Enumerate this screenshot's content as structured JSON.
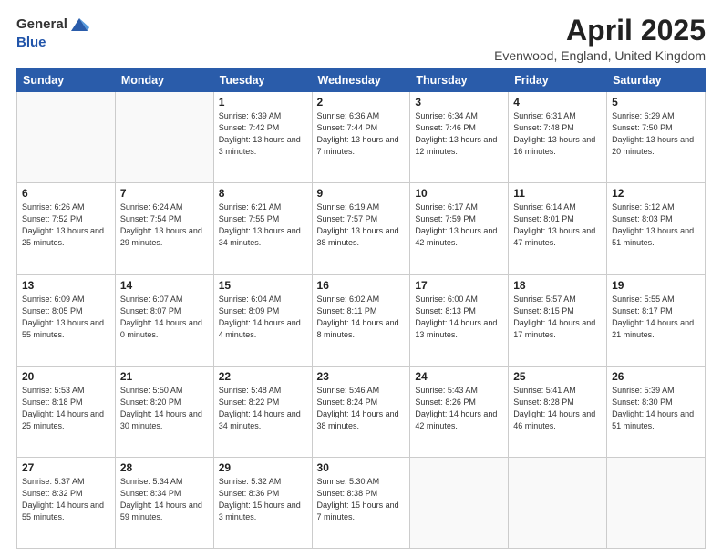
{
  "header": {
    "logo_general": "General",
    "logo_blue": "Blue",
    "month_year": "April 2025",
    "location": "Evenwood, England, United Kingdom"
  },
  "days_of_week": [
    "Sunday",
    "Monday",
    "Tuesday",
    "Wednesday",
    "Thursday",
    "Friday",
    "Saturday"
  ],
  "weeks": [
    [
      {
        "day": "",
        "info": ""
      },
      {
        "day": "",
        "info": ""
      },
      {
        "day": "1",
        "info": "Sunrise: 6:39 AM\nSunset: 7:42 PM\nDaylight: 13 hours and 3 minutes."
      },
      {
        "day": "2",
        "info": "Sunrise: 6:36 AM\nSunset: 7:44 PM\nDaylight: 13 hours and 7 minutes."
      },
      {
        "day": "3",
        "info": "Sunrise: 6:34 AM\nSunset: 7:46 PM\nDaylight: 13 hours and 12 minutes."
      },
      {
        "day": "4",
        "info": "Sunrise: 6:31 AM\nSunset: 7:48 PM\nDaylight: 13 hours and 16 minutes."
      },
      {
        "day": "5",
        "info": "Sunrise: 6:29 AM\nSunset: 7:50 PM\nDaylight: 13 hours and 20 minutes."
      }
    ],
    [
      {
        "day": "6",
        "info": "Sunrise: 6:26 AM\nSunset: 7:52 PM\nDaylight: 13 hours and 25 minutes."
      },
      {
        "day": "7",
        "info": "Sunrise: 6:24 AM\nSunset: 7:54 PM\nDaylight: 13 hours and 29 minutes."
      },
      {
        "day": "8",
        "info": "Sunrise: 6:21 AM\nSunset: 7:55 PM\nDaylight: 13 hours and 34 minutes."
      },
      {
        "day": "9",
        "info": "Sunrise: 6:19 AM\nSunset: 7:57 PM\nDaylight: 13 hours and 38 minutes."
      },
      {
        "day": "10",
        "info": "Sunrise: 6:17 AM\nSunset: 7:59 PM\nDaylight: 13 hours and 42 minutes."
      },
      {
        "day": "11",
        "info": "Sunrise: 6:14 AM\nSunset: 8:01 PM\nDaylight: 13 hours and 47 minutes."
      },
      {
        "day": "12",
        "info": "Sunrise: 6:12 AM\nSunset: 8:03 PM\nDaylight: 13 hours and 51 minutes."
      }
    ],
    [
      {
        "day": "13",
        "info": "Sunrise: 6:09 AM\nSunset: 8:05 PM\nDaylight: 13 hours and 55 minutes."
      },
      {
        "day": "14",
        "info": "Sunrise: 6:07 AM\nSunset: 8:07 PM\nDaylight: 14 hours and 0 minutes."
      },
      {
        "day": "15",
        "info": "Sunrise: 6:04 AM\nSunset: 8:09 PM\nDaylight: 14 hours and 4 minutes."
      },
      {
        "day": "16",
        "info": "Sunrise: 6:02 AM\nSunset: 8:11 PM\nDaylight: 14 hours and 8 minutes."
      },
      {
        "day": "17",
        "info": "Sunrise: 6:00 AM\nSunset: 8:13 PM\nDaylight: 14 hours and 13 minutes."
      },
      {
        "day": "18",
        "info": "Sunrise: 5:57 AM\nSunset: 8:15 PM\nDaylight: 14 hours and 17 minutes."
      },
      {
        "day": "19",
        "info": "Sunrise: 5:55 AM\nSunset: 8:17 PM\nDaylight: 14 hours and 21 minutes."
      }
    ],
    [
      {
        "day": "20",
        "info": "Sunrise: 5:53 AM\nSunset: 8:18 PM\nDaylight: 14 hours and 25 minutes."
      },
      {
        "day": "21",
        "info": "Sunrise: 5:50 AM\nSunset: 8:20 PM\nDaylight: 14 hours and 30 minutes."
      },
      {
        "day": "22",
        "info": "Sunrise: 5:48 AM\nSunset: 8:22 PM\nDaylight: 14 hours and 34 minutes."
      },
      {
        "day": "23",
        "info": "Sunrise: 5:46 AM\nSunset: 8:24 PM\nDaylight: 14 hours and 38 minutes."
      },
      {
        "day": "24",
        "info": "Sunrise: 5:43 AM\nSunset: 8:26 PM\nDaylight: 14 hours and 42 minutes."
      },
      {
        "day": "25",
        "info": "Sunrise: 5:41 AM\nSunset: 8:28 PM\nDaylight: 14 hours and 46 minutes."
      },
      {
        "day": "26",
        "info": "Sunrise: 5:39 AM\nSunset: 8:30 PM\nDaylight: 14 hours and 51 minutes."
      }
    ],
    [
      {
        "day": "27",
        "info": "Sunrise: 5:37 AM\nSunset: 8:32 PM\nDaylight: 14 hours and 55 minutes."
      },
      {
        "day": "28",
        "info": "Sunrise: 5:34 AM\nSunset: 8:34 PM\nDaylight: 14 hours and 59 minutes."
      },
      {
        "day": "29",
        "info": "Sunrise: 5:32 AM\nSunset: 8:36 PM\nDaylight: 15 hours and 3 minutes."
      },
      {
        "day": "30",
        "info": "Sunrise: 5:30 AM\nSunset: 8:38 PM\nDaylight: 15 hours and 7 minutes."
      },
      {
        "day": "",
        "info": ""
      },
      {
        "day": "",
        "info": ""
      },
      {
        "day": "",
        "info": ""
      }
    ]
  ]
}
